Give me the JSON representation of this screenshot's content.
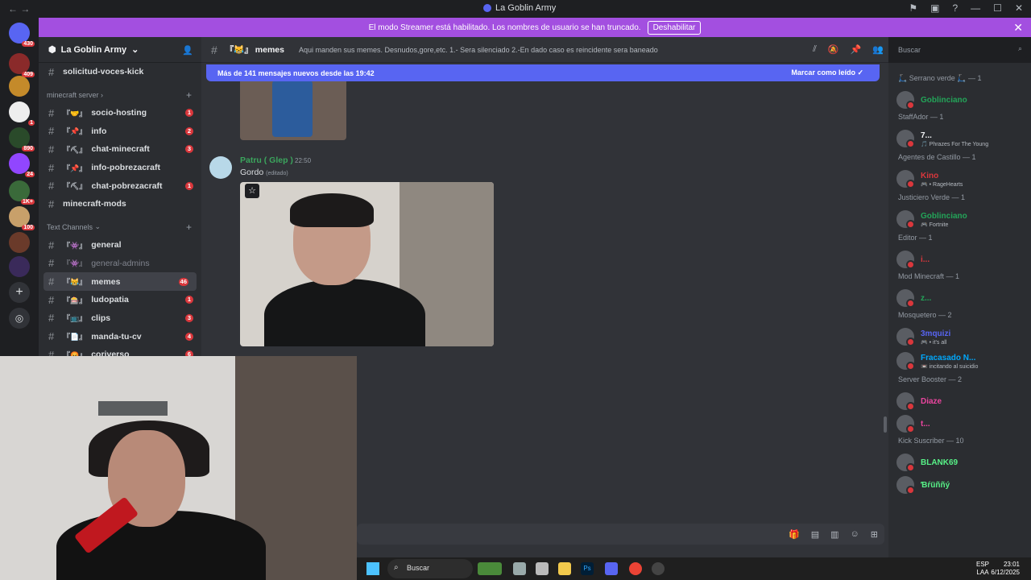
{
  "window": {
    "title": "La Goblin Army"
  },
  "banner": {
    "text": "El modo Streamer está habilitado. Los nombres de usuario se han truncado.",
    "button": "Deshabilitar"
  },
  "servers": [
    {
      "badge": "430"
    },
    {
      "badge": "409"
    },
    {
      "badge": ""
    },
    {
      "badge": "1"
    },
    {
      "badge": "890"
    },
    {
      "badge": "24"
    },
    {
      "badge": "1K+"
    },
    {
      "badge": "100"
    },
    {
      "badge": ""
    },
    {
      "badge": ""
    }
  ],
  "guild": {
    "name": "La Goblin Army"
  },
  "channels_top": [
    {
      "name": "solicitud-voces-kick",
      "pre": "",
      "badge": ""
    }
  ],
  "category1": "minecraft server",
  "channels_mc": [
    {
      "name": "socio-hosting",
      "pre": "『🤝』",
      "badge": "1"
    },
    {
      "name": "info",
      "pre": "『📌』",
      "badge": "2"
    },
    {
      "name": "chat-minecraft",
      "pre": "『⛏』",
      "badge": "3"
    },
    {
      "name": "info-pobrezacraft",
      "pre": "『📌』",
      "badge": ""
    },
    {
      "name": "chat-pobrezacraft",
      "pre": "『⛏』",
      "badge": "1"
    },
    {
      "name": "minecraft-mods",
      "pre": "",
      "badge": ""
    }
  ],
  "category2": "Text Channels",
  "channels_text": [
    {
      "name": "general",
      "pre": "『👾』",
      "badge": ""
    },
    {
      "name": "general-admins",
      "pre": "『👾』",
      "badge": ""
    },
    {
      "name": "memes",
      "pre": "『😹』",
      "badge": "46"
    },
    {
      "name": "ludopatia",
      "pre": "『🎰』",
      "badge": "1"
    },
    {
      "name": "clips",
      "pre": "『📺』",
      "badge": "3"
    },
    {
      "name": "manda-tu-cv",
      "pre": "『📄』",
      "badge": "4"
    },
    {
      "name": "coriverso",
      "pre": "『😡』",
      "badge": "6"
    }
  ],
  "header": {
    "channel": "『😹』 memes",
    "topic": "Aqui manden sus memes. Desnudos,gore,etc. 1.- Sera silenciado 2.-En dado caso es reincidente sera baneado"
  },
  "search": {
    "placeholder": "Buscar"
  },
  "newmsgs": {
    "text": "Más de 141 mensajes nuevos desde las 19:42",
    "mark": "Marcar como leído"
  },
  "message": {
    "author": "Patru ( Glep )",
    "time": "22:50",
    "content": "Gordo",
    "edited": "(editado)"
  },
  "members": [
    {
      "cat": "🛴 Serrano verde 🛴 — 1"
    },
    {
      "name": "Goblinciano",
      "status": "",
      "color": "#23a559"
    },
    {
      "cat": "StaffAdor — 1"
    },
    {
      "name": "7...",
      "status": "🎵 Phrazes For The Young",
      "color": "#f2f3f5"
    },
    {
      "cat": "Agentes de Castillo — 1"
    },
    {
      "name": "Kino",
      "status": "🎮 • RageHearts",
      "color": "#da373c"
    },
    {
      "cat": "Justiciero Verde — 1"
    },
    {
      "name": "Goblinciano",
      "status": "🎮 Fortnite",
      "color": "#23a559"
    },
    {
      "cat": "Editor — 1"
    },
    {
      "name": "i...",
      "status": "",
      "color": "#da373c"
    },
    {
      "cat": "Mod Minecraft — 1"
    },
    {
      "name": "z...",
      "status": "",
      "color": "#23a559"
    },
    {
      "cat": "Mosquetero — 2"
    },
    {
      "name": "3mquizi",
      "status": "🎮 • it's all",
      "color": "#5865f2"
    },
    {
      "name": "Fracasado N...",
      "status": "📼 incitando al suicidio",
      "color": "#00a8fc"
    },
    {
      "cat": "Server Booster — 2"
    },
    {
      "name": "Diaze",
      "status": "",
      "color": "#eb459f"
    },
    {
      "name": "t...",
      "status": "",
      "color": "#eb459f"
    },
    {
      "cat": "Kick Suscriber — 10"
    },
    {
      "name": "BLANK69",
      "status": "",
      "color": "#57f287"
    },
    {
      "name": "Ɓŕüññý",
      "status": "",
      "color": "#57f287"
    }
  ],
  "taskbar": {
    "search": "Buscar",
    "lang": "ESP",
    "lang2": "LAA",
    "time": "23:01",
    "date": "6/12/2025"
  }
}
